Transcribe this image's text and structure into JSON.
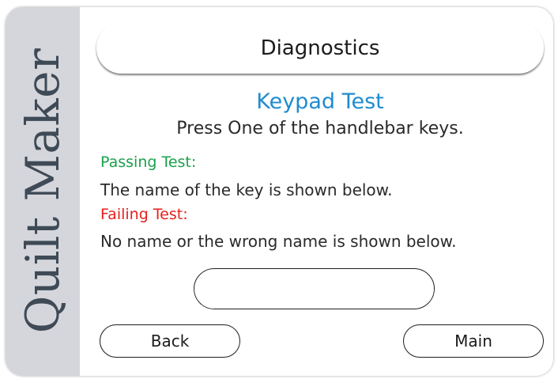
{
  "brand": {
    "name": "Quilt Maker"
  },
  "header": {
    "title": "Diagnostics"
  },
  "test": {
    "title": "Keypad Test",
    "instruction": "Press One of the handlebar keys.",
    "passing_label": "Passing Test:",
    "passing_text": "The name of the key is shown below.",
    "failing_label": "Failing Test:",
    "failing_text": "No name or the wrong name is shown below.",
    "key_name": ""
  },
  "buttons": {
    "back_label": "Back",
    "main_label": "Main"
  },
  "colors": {
    "accent": "#1e8ccf",
    "pass": "#1aa04a",
    "fail": "#e8201c",
    "brand_panel": "#d4d6db"
  }
}
